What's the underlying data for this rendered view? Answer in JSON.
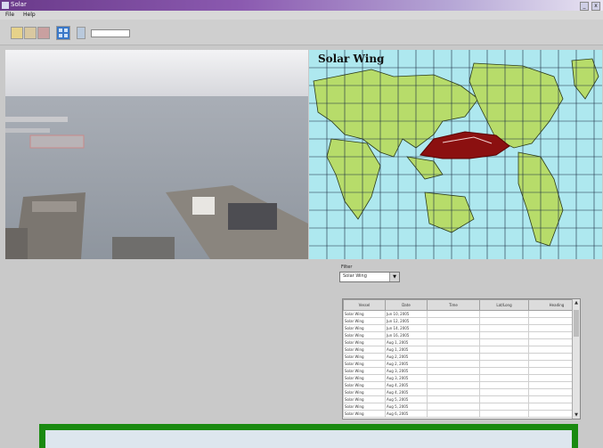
{
  "window": {
    "title": "Solar",
    "min_label": "_",
    "close_label": "x"
  },
  "menu": [
    {
      "label": "File"
    },
    {
      "label": "Help"
    }
  ],
  "toolbar": {
    "coord_readout": ""
  },
  "map": {
    "title": "Solar Wing"
  },
  "controls": {
    "label": "Filter",
    "selected": "Solar Wing"
  },
  "table": {
    "columns": [
      "Vessel",
      "Date",
      "Time",
      "Lat/Long",
      "Heading"
    ],
    "rows": [
      [
        "Solar Wing",
        "Jun 10, 2005",
        "",
        "",
        ""
      ],
      [
        "Solar Wing",
        "Jun 12, 2005",
        "",
        "",
        ""
      ],
      [
        "Solar Wing",
        "Jun 14, 2005",
        "",
        "",
        ""
      ],
      [
        "Solar Wing",
        "Jun 16, 2005",
        "",
        "",
        ""
      ],
      [
        "Solar Wing",
        "Aug 1, 2005",
        "",
        "",
        ""
      ],
      [
        "Solar Wing",
        "Aug 1, 2005",
        "",
        "",
        ""
      ],
      [
        "Solar Wing",
        "Aug 2, 2005",
        "",
        "",
        ""
      ],
      [
        "Solar Wing",
        "Aug 2, 2005",
        "",
        "",
        ""
      ],
      [
        "Solar Wing",
        "Aug 3, 2005",
        "",
        "",
        ""
      ],
      [
        "Solar Wing",
        "Aug 3, 2005",
        "",
        "",
        ""
      ],
      [
        "Solar Wing",
        "Aug 4, 2005",
        "",
        "",
        ""
      ],
      [
        "Solar Wing",
        "Aug 4, 2005",
        "",
        "",
        ""
      ],
      [
        "Solar Wing",
        "Aug 5, 2005",
        "",
        "",
        ""
      ],
      [
        "Solar Wing",
        "Aug 5, 2005",
        "",
        "",
        ""
      ],
      [
        "Solar Wing",
        "Aug 6, 2005",
        "",
        "",
        ""
      ]
    ]
  },
  "colors": {
    "highlight_border": "#1a8a10",
    "ocean": "#aee8ef",
    "land": "#b7dc6a",
    "track": "#8b1010"
  },
  "icons": [
    "open-icon",
    "save-icon",
    "print-icon",
    "grid-view-icon",
    "layers-icon"
  ]
}
